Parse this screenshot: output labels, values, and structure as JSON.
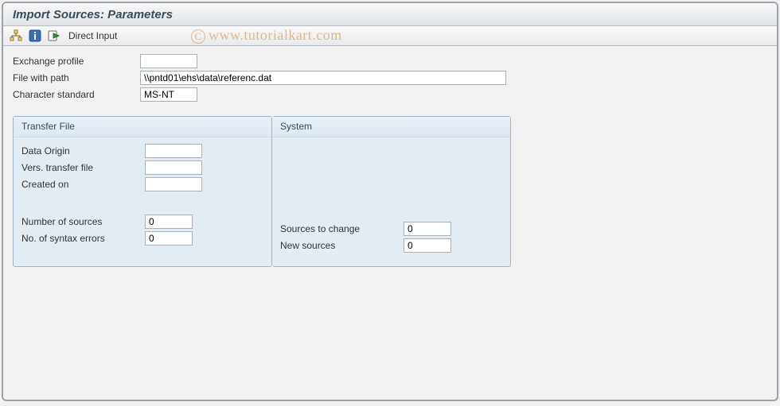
{
  "title": "Import Sources: Parameters",
  "toolbar": {
    "direct_input_label": "Direct Input"
  },
  "form": {
    "exchange_profile_label": "Exchange profile",
    "exchange_profile_value": "",
    "file_path_label": "File with path",
    "file_path_value": "\\\\pntd01\\ehs\\data\\referenc.dat",
    "char_std_label": "Character standard",
    "char_std_value": "MS-NT"
  },
  "transfer_panel": {
    "title": "Transfer File",
    "data_origin_label": "Data Origin",
    "data_origin_value": "",
    "vers_label": "Vers. transfer file",
    "vers_value": "",
    "created_label": "Created on",
    "created_value": "",
    "num_sources_label": "Number of sources",
    "num_sources_value": "0",
    "syntax_label": "No. of syntax errors",
    "syntax_value": "0"
  },
  "system_panel": {
    "title": "System",
    "to_change_label": "Sources to change",
    "to_change_value": "0",
    "new_sources_label": "New sources",
    "new_sources_value": "0"
  },
  "watermark": "www.tutorialkart.com"
}
